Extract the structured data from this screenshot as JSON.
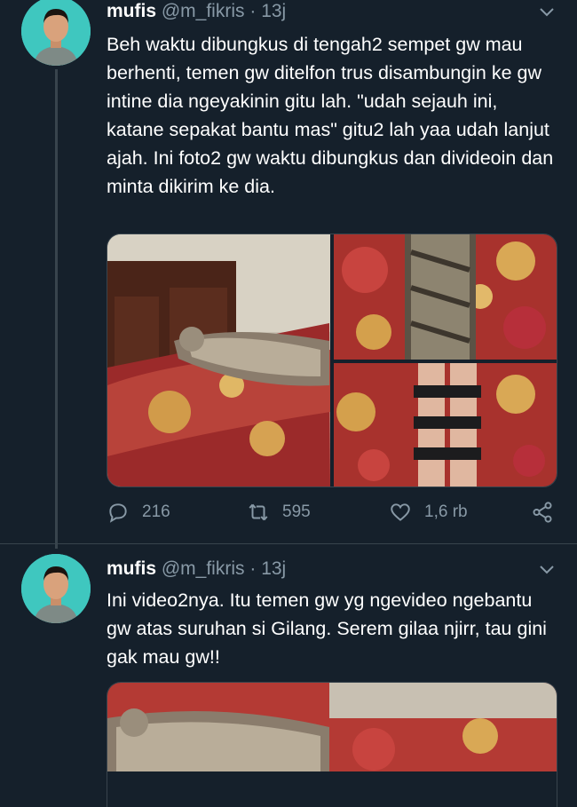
{
  "tweets": [
    {
      "name": "mufis",
      "handle": "@m_fikris",
      "dot": "·",
      "time": "13j",
      "text": "Beh waktu dibungkus di tengah2 sempet gw mau berhenti, temen gw ditelfon trus disambungin ke gw intine dia ngeyakinin gitu lah. \"udah sejauh ini, katane sepakat bantu mas\" gitu2 lah yaa udah lanjut ajah. Ini foto2 gw waktu dibungkus dan divideoin dan minta dikirim ke dia.",
      "replies": "216",
      "retweets": "595",
      "likes": "1,6 rb"
    },
    {
      "name": "mufis",
      "handle": "@m_fikris",
      "dot": "·",
      "time": "13j",
      "text": "Ini video2nya. Itu temen gw yg ngevideo ngebantu gw atas suruhan si Gilang. Serem gilaa njirr, tau gini gak mau gw!!"
    }
  ],
  "icons": {
    "reply": "reply-icon",
    "retweet": "retweet-icon",
    "like": "heart-icon",
    "share": "share-icon",
    "menu": "chevron-down-icon"
  },
  "colors": {
    "background": "#15202b",
    "secondary_text": "#8899a6",
    "divider": "#38444d",
    "avatar_bg": "#3fc7bf"
  }
}
